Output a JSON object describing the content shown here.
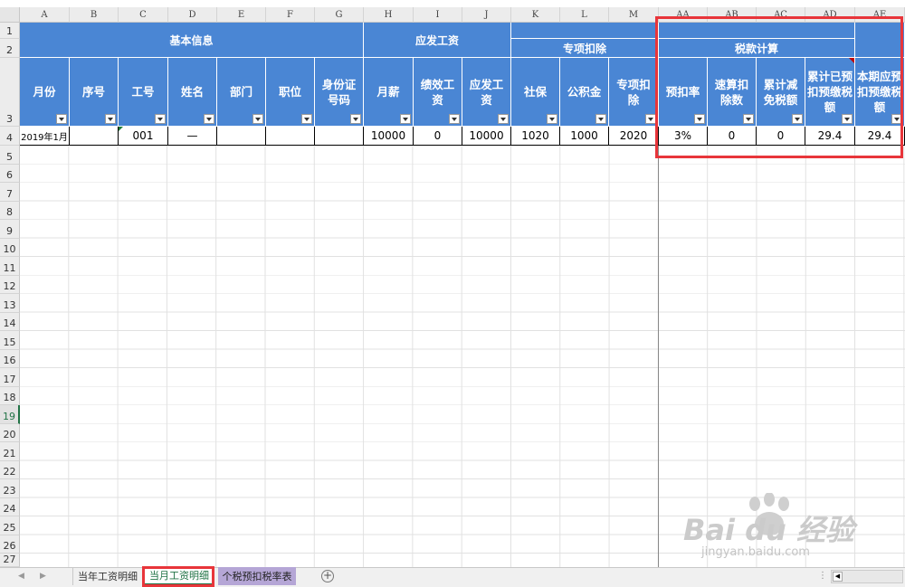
{
  "columns": [
    "A",
    "B",
    "C",
    "D",
    "E",
    "F",
    "G",
    "H",
    "I",
    "J",
    "K",
    "L",
    "M",
    "AA",
    "AB",
    "AC",
    "AD",
    "AE"
  ],
  "rows": [
    "1",
    "2",
    "3",
    "4",
    "5",
    "6",
    "7",
    "8",
    "9",
    "10",
    "11",
    "12",
    "13",
    "14",
    "15",
    "16",
    "17",
    "18",
    "19",
    "20",
    "21",
    "22",
    "23",
    "24",
    "25",
    "26",
    "27"
  ],
  "selected_row": "19",
  "groups": {
    "basic_info": "基本信息",
    "gross_pay": "应发工资",
    "special_deduction": "专项扣除",
    "tax_calc": "税款计算"
  },
  "headers": {
    "month": "月份",
    "seq": "序号",
    "emp_id": "工号",
    "name": "姓名",
    "dept": "部门",
    "position": "职位",
    "id_number": "身份证号码",
    "monthly_salary": "月薪",
    "performance": "绩效工资",
    "gross": "应发工资",
    "social_security": "社保",
    "housing_fund": "公积金",
    "special_deduction": "专项扣除",
    "withholding_rate": "预扣率",
    "quick_deduction": "速算扣除数",
    "cum_tax_relief": "累计减免税额",
    "cum_prepaid_tax": "累计已预扣预缴税额",
    "current_tax": "本期应预扣预缴税额"
  },
  "row4": {
    "month": "2019年1月",
    "seq": "",
    "emp_id": "001",
    "name": "—",
    "dept": "",
    "position": "",
    "id_number": "",
    "monthly_salary": "10000",
    "performance": "0",
    "gross": "10000",
    "social_security": "1020",
    "housing_fund": "1000",
    "special_deduction": "2020",
    "withholding_rate": "3%",
    "quick_deduction": "0",
    "cum_tax_relief": "0",
    "cum_prepaid_tax": "29.4",
    "current_tax": "29.4"
  },
  "sheet_tabs": [
    "当年工资明细",
    "当月工资明细",
    "个税预扣税率表"
  ],
  "active_tab": "当月工资明细",
  "watermark": {
    "brand": "Bai du 经验",
    "url": "jingyan.baidu.com"
  },
  "colors": {
    "header_blue": "#4a86d4",
    "highlight_red": "#e8353a",
    "active_tab_green": "#217346",
    "purple_tab": "#b5a6d6"
  }
}
